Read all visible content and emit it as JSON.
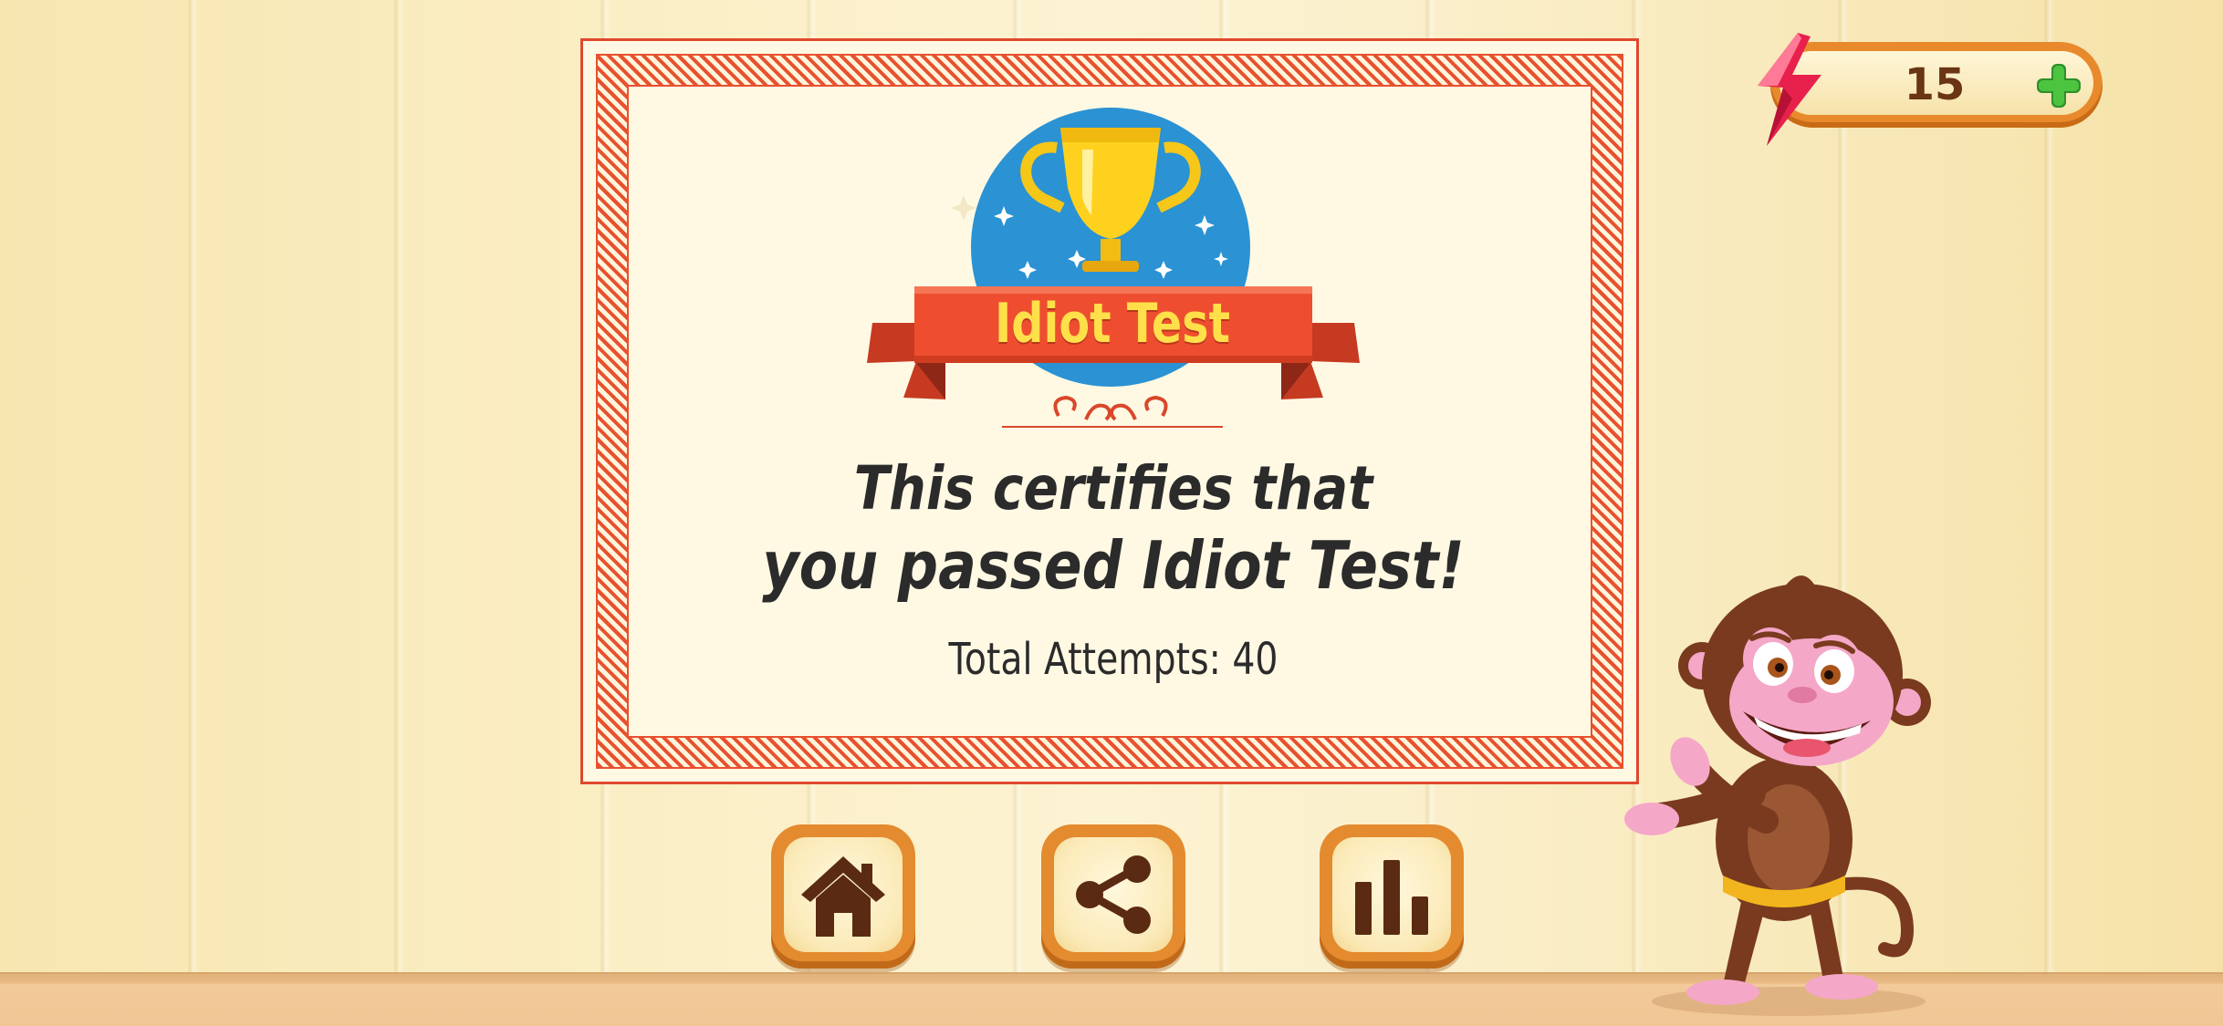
{
  "energy": {
    "count": "15",
    "icon": "lightning-bolt-icon",
    "add_icon": "plus-icon"
  },
  "certificate": {
    "badge_title": "Idiot Test",
    "line1": "This certifies that",
    "line2": "you passed Idiot Test!",
    "attempts": "Total Attempts: 40",
    "icon": "trophy-icon"
  },
  "buttons": [
    {
      "name": "home",
      "icon": "home-icon"
    },
    {
      "name": "share",
      "icon": "share-icon"
    },
    {
      "name": "stats",
      "icon": "bar-chart-icon"
    }
  ],
  "colors": {
    "accent": "#e8512f",
    "button": "#e48a2f",
    "title_text": "#ffe04a",
    "badge_blue": "#2b92d3"
  }
}
